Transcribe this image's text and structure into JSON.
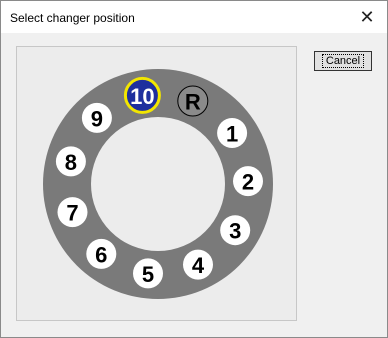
{
  "window": {
    "title": "Select changer position",
    "close_glyph": "✕"
  },
  "buttons": {
    "cancel_label": "Cancel"
  },
  "changer": {
    "positions": [
      {
        "label": "10",
        "selected": true
      },
      {
        "label": "R",
        "selected": false
      },
      {
        "label": "1",
        "selected": false
      },
      {
        "label": "2",
        "selected": false
      },
      {
        "label": "3",
        "selected": false
      },
      {
        "label": "4",
        "selected": false
      },
      {
        "label": "5",
        "selected": false
      },
      {
        "label": "6",
        "selected": false
      },
      {
        "label": "7",
        "selected": false
      },
      {
        "label": "8",
        "selected": false
      },
      {
        "label": "9",
        "selected": false
      }
    ],
    "colors": {
      "ring": "#7a7a7a",
      "slot_fill": "#ffffff",
      "selected_fill": "#1e2f9e",
      "selected_border": "#f2e600",
      "reference_fill": "#8a8a8a",
      "label": "#000000",
      "selected_label": "#ffffff"
    }
  }
}
